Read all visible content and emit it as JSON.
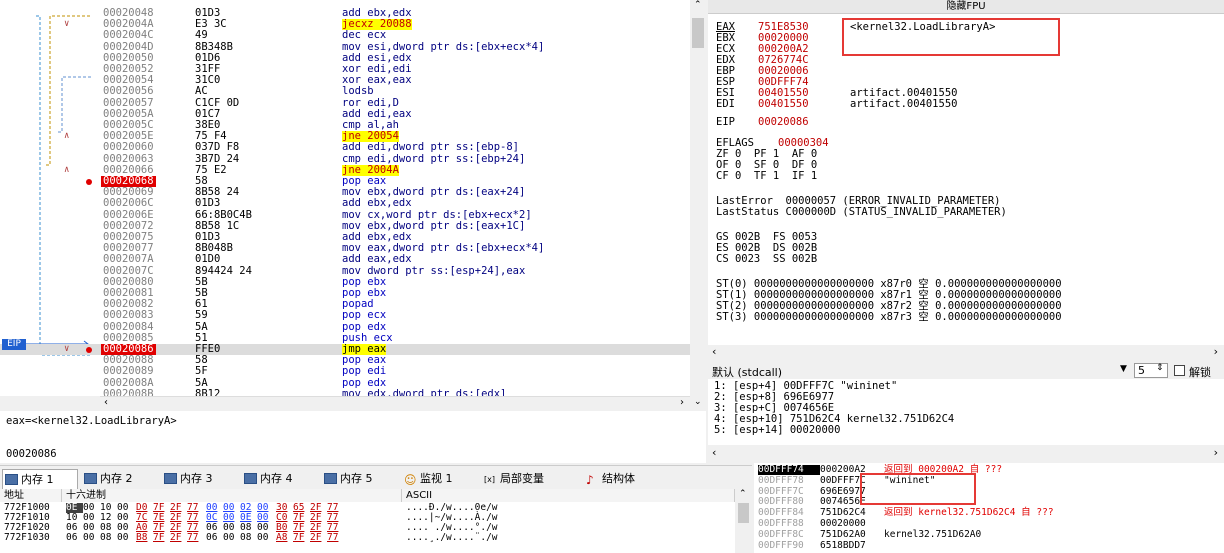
{
  "colors": {
    "accent_red": "#e53935",
    "eip_blue": "#2060d0",
    "highlight": "#ffff00"
  },
  "disasm": {
    "rows": [
      {
        "jmp": "",
        "addr": "00020048",
        "bytes": "01D3",
        "instr": "add ebx,edx"
      },
      {
        "jmp": "∨",
        "addr": "0002004A",
        "bytes": "E3 3C",
        "instr": "jecxz 20088"
      },
      {
        "jmp": "",
        "addr": "0002004C",
        "bytes": "49",
        "instr": "dec ecx"
      },
      {
        "jmp": "",
        "addr": "0002004D",
        "bytes": "8B348B",
        "instr": "mov esi,dword ptr ds:[ebx+ecx*4]"
      },
      {
        "jmp": "",
        "addr": "00020050",
        "bytes": "01D6",
        "instr": "add esi,edx"
      },
      {
        "jmp": "",
        "addr": "00020052",
        "bytes": "31FF",
        "instr": "xor edi,edi"
      },
      {
        "jmp": "",
        "addr": "00020054",
        "bytes": "31C0",
        "instr": "xor eax,eax"
      },
      {
        "jmp": "",
        "addr": "00020056",
        "bytes": "AC",
        "instr": "lodsb"
      },
      {
        "jmp": "",
        "addr": "00020057",
        "bytes": "C1CF 0D",
        "instr": "ror edi,D"
      },
      {
        "jmp": "",
        "addr": "0002005A",
        "bytes": "01C7",
        "instr": "add edi,eax"
      },
      {
        "jmp": "",
        "addr": "0002005C",
        "bytes": "38E0",
        "instr": "cmp al,ah"
      },
      {
        "jmp": "∧",
        "addr": "0002005E",
        "bytes": "75 F4",
        "instr": "jne 20054"
      },
      {
        "jmp": "",
        "addr": "00020060",
        "bytes": "037D F8",
        "instr": "add edi,dword ptr ss:[ebp-8]"
      },
      {
        "jmp": "",
        "addr": "00020063",
        "bytes": "3B7D 24",
        "instr": "cmp edi,dword ptr ss:[ebp+24]"
      },
      {
        "jmp": "∧",
        "addr": "00020066",
        "bytes": "75 E2",
        "instr": "jne 2004A"
      },
      {
        "jmp": "",
        "addr": "00020068",
        "bytes": "58",
        "instr": "pop eax"
      },
      {
        "jmp": "",
        "addr": "00020069",
        "bytes": "8B58 24",
        "instr": "mov ebx,dword ptr ds:[eax+24]"
      },
      {
        "jmp": "",
        "addr": "0002006C",
        "bytes": "01D3",
        "instr": "add ebx,edx"
      },
      {
        "jmp": "",
        "addr": "0002006E",
        "bytes": "66:8B0C4B",
        "instr": "mov cx,word ptr ds:[ebx+ecx*2]"
      },
      {
        "jmp": "",
        "addr": "00020072",
        "bytes": "8B58 1C",
        "instr": "mov ebx,dword ptr ds:[eax+1C]"
      },
      {
        "jmp": "",
        "addr": "00020075",
        "bytes": "01D3",
        "instr": "add ebx,edx"
      },
      {
        "jmp": "",
        "addr": "00020077",
        "bytes": "8B048B",
        "instr": "mov eax,dword ptr ds:[ebx+ecx*4]"
      },
      {
        "jmp": "",
        "addr": "0002007A",
        "bytes": "01D0",
        "instr": "add eax,edx"
      },
      {
        "jmp": "",
        "addr": "0002007C",
        "bytes": "894424 24",
        "instr": "mov dword ptr ss:[esp+24],eax"
      },
      {
        "jmp": "",
        "addr": "00020080",
        "bytes": "5B",
        "instr": "pop ebx"
      },
      {
        "jmp": "",
        "addr": "00020081",
        "bytes": "5B",
        "instr": "pop ebx"
      },
      {
        "jmp": "",
        "addr": "00020082",
        "bytes": "61",
        "instr": "popad"
      },
      {
        "jmp": "",
        "addr": "00020083",
        "bytes": "59",
        "instr": "pop ecx"
      },
      {
        "jmp": "",
        "addr": "00020084",
        "bytes": "5A",
        "instr": "pop edx"
      },
      {
        "jmp": "",
        "addr": "00020085",
        "bytes": "51",
        "instr": "push ecx"
      },
      {
        "jmp": "∨",
        "addr": "00020086",
        "bytes": "FFE0",
        "instr": "jmp eax"
      },
      {
        "jmp": "",
        "addr": "00020088",
        "bytes": "58",
        "instr": "pop eax"
      },
      {
        "jmp": "",
        "addr": "00020089",
        "bytes": "5F",
        "instr": "pop edi"
      },
      {
        "jmp": "",
        "addr": "0002008A",
        "bytes": "5A",
        "instr": "pop edx"
      },
      {
        "jmp": "",
        "addr": "0002008B",
        "bytes": "8B12",
        "instr": "mov edx,dword ptr ds:[edx]"
      }
    ],
    "eip_label": "EIP"
  },
  "info": {
    "line1": "eax=<kernel32.LoadLibraryA>",
    "line2": "00020086"
  },
  "registers": {
    "title": "隐藏FPU",
    "gp": [
      {
        "name": "EAX",
        "value": "751E8530",
        "sym": "<kernel32.LoadLibraryA>"
      },
      {
        "name": "EBX",
        "value": "00020000",
        "sym": ""
      },
      {
        "name": "ECX",
        "value": "000200A2",
        "sym": ""
      },
      {
        "name": "EDX",
        "value": "0726774C",
        "sym": ""
      },
      {
        "name": "EBP",
        "value": "00020006",
        "sym": ""
      },
      {
        "name": "ESP",
        "value": "00DFFF74",
        "sym": ""
      },
      {
        "name": "ESI",
        "value": "00401550",
        "sym": "artifact.00401550"
      },
      {
        "name": "EDI",
        "value": "00401550",
        "sym": "artifact.00401550"
      }
    ],
    "eip": {
      "name": "EIP",
      "value": "00020086"
    },
    "eflags": {
      "name": "EFLAGS",
      "value": "00000304"
    },
    "flags": [
      "ZF 0  PF 1  AF 0",
      "OF 0  SF 0  DF 0",
      "CF 0  TF 1  IF 1"
    ],
    "last_error": "LastError  00000057 (ERROR_INVALID_PARAMETER)",
    "last_status": "LastStatus C000000D (STATUS_INVALID_PARAMETER)",
    "segs": [
      "GS 002B  FS 0053",
      "ES 002B  DS 002B",
      "CS 0023  SS 002B"
    ],
    "fpu": [
      "ST(0) 0000000000000000000 x87r0 空 0.000000000000000000",
      "ST(1) 0000000000000000000 x87r1 空 0.000000000000000000",
      "ST(2) 0000000000000000000 x87r2 空 0.000000000000000000",
      "ST(3) 0000000000000000000 x87r3 空 0.000000000000000000"
    ]
  },
  "callconv": {
    "label": "默认 (stdcall)",
    "count": "5",
    "unlock_label": "解锁"
  },
  "args": [
    "1: [esp+4] 00DFFF7C \"wininet\"",
    "2: [esp+8] 696E6977",
    "3: [esp+C] 0074656E",
    "4: [esp+10] 751D62C4 kernel32.751D62C4",
    "5: [esp+14] 00020000"
  ],
  "tabs": [
    "内存 1",
    "内存 2",
    "内存 3",
    "内存 4",
    "内存 5",
    "监视 1",
    "局部变量",
    "结构体"
  ],
  "dump": {
    "headers": {
      "addr": "地址",
      "hex": "十六进制",
      "ascii": "ASCII"
    },
    "rows": [
      {
        "addr": "772F1000",
        "hex": [
          "0E",
          "00",
          "10",
          "00",
          "D0",
          "7F",
          "2F",
          "77",
          "00",
          "00",
          "02",
          "00",
          "30",
          "65",
          "2F",
          "77"
        ],
        "ascii": "....Ð./w....0e/w"
      },
      {
        "addr": "772F1010",
        "hex": [
          "10",
          "00",
          "12",
          "00",
          "7C",
          "7E",
          "2F",
          "77",
          "0C",
          "00",
          "0E",
          "00",
          "C0",
          "7F",
          "2F",
          "77"
        ],
        "ascii": "....|~/w....À./w"
      },
      {
        "addr": "772F1020",
        "hex": [
          "06",
          "00",
          "08",
          "00",
          "A0",
          "7F",
          "2F",
          "77",
          "06",
          "00",
          "08",
          "00",
          "B0",
          "7F",
          "2F",
          "77"
        ],
        "ascii": ".... ./w....°./w"
      },
      {
        "addr": "772F1030",
        "hex": [
          "06",
          "00",
          "08",
          "00",
          "B8",
          "7F",
          "2F",
          "77",
          "06",
          "00",
          "08",
          "00",
          "A8",
          "7F",
          "2F",
          "77"
        ],
        "ascii": "....¸./w....¨./w"
      }
    ]
  },
  "stack": [
    {
      "addr": "00DFFF74",
      "val": "000200A2",
      "cmt": "返回到 000200A2 自 ???",
      "cur": true
    },
    {
      "addr": "00DFFF78",
      "val": "00DFFF7C",
      "cmt": "\"wininet\"",
      "cur": false
    },
    {
      "addr": "00DFFF7C",
      "val": "696E6977",
      "cmt": "",
      "cur": false
    },
    {
      "addr": "00DFFF80",
      "val": "0074656E",
      "cmt": "",
      "cur": false
    },
    {
      "addr": "00DFFF84",
      "val": "751D62C4",
      "cmt": "返回到 kernel32.751D62C4 自 ???",
      "cur": false
    },
    {
      "addr": "00DFFF88",
      "val": "00020000",
      "cmt": "",
      "cur": false
    },
    {
      "addr": "00DFFF8C",
      "val": "751D62A0",
      "cmt": "kernel32.751D62A0",
      "cur": false
    },
    {
      "addr": "00DFFF90",
      "val": "6518BDD7",
      "cmt": "",
      "cur": false
    }
  ]
}
